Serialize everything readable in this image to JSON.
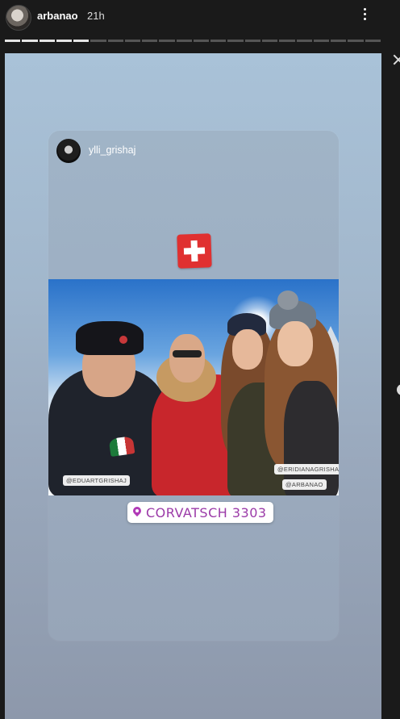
{
  "header": {
    "username": "arbanao",
    "time": "21h",
    "progress": {
      "total": 22,
      "completed": 5
    }
  },
  "story": {
    "shared_post": {
      "username": "ylli_grishaj",
      "flag_emoji": "swiss-flag",
      "photo_tags": [
        "@EDUARTGRISHAJ",
        "@ERIDIANAGRISHAJ",
        "@ARBANAO"
      ],
      "location": "CORVATSCH 3303"
    }
  },
  "colors": {
    "story_bg": "#a2b7cc",
    "location_text": "#9b3aa8",
    "swiss_red": "#e03030"
  }
}
